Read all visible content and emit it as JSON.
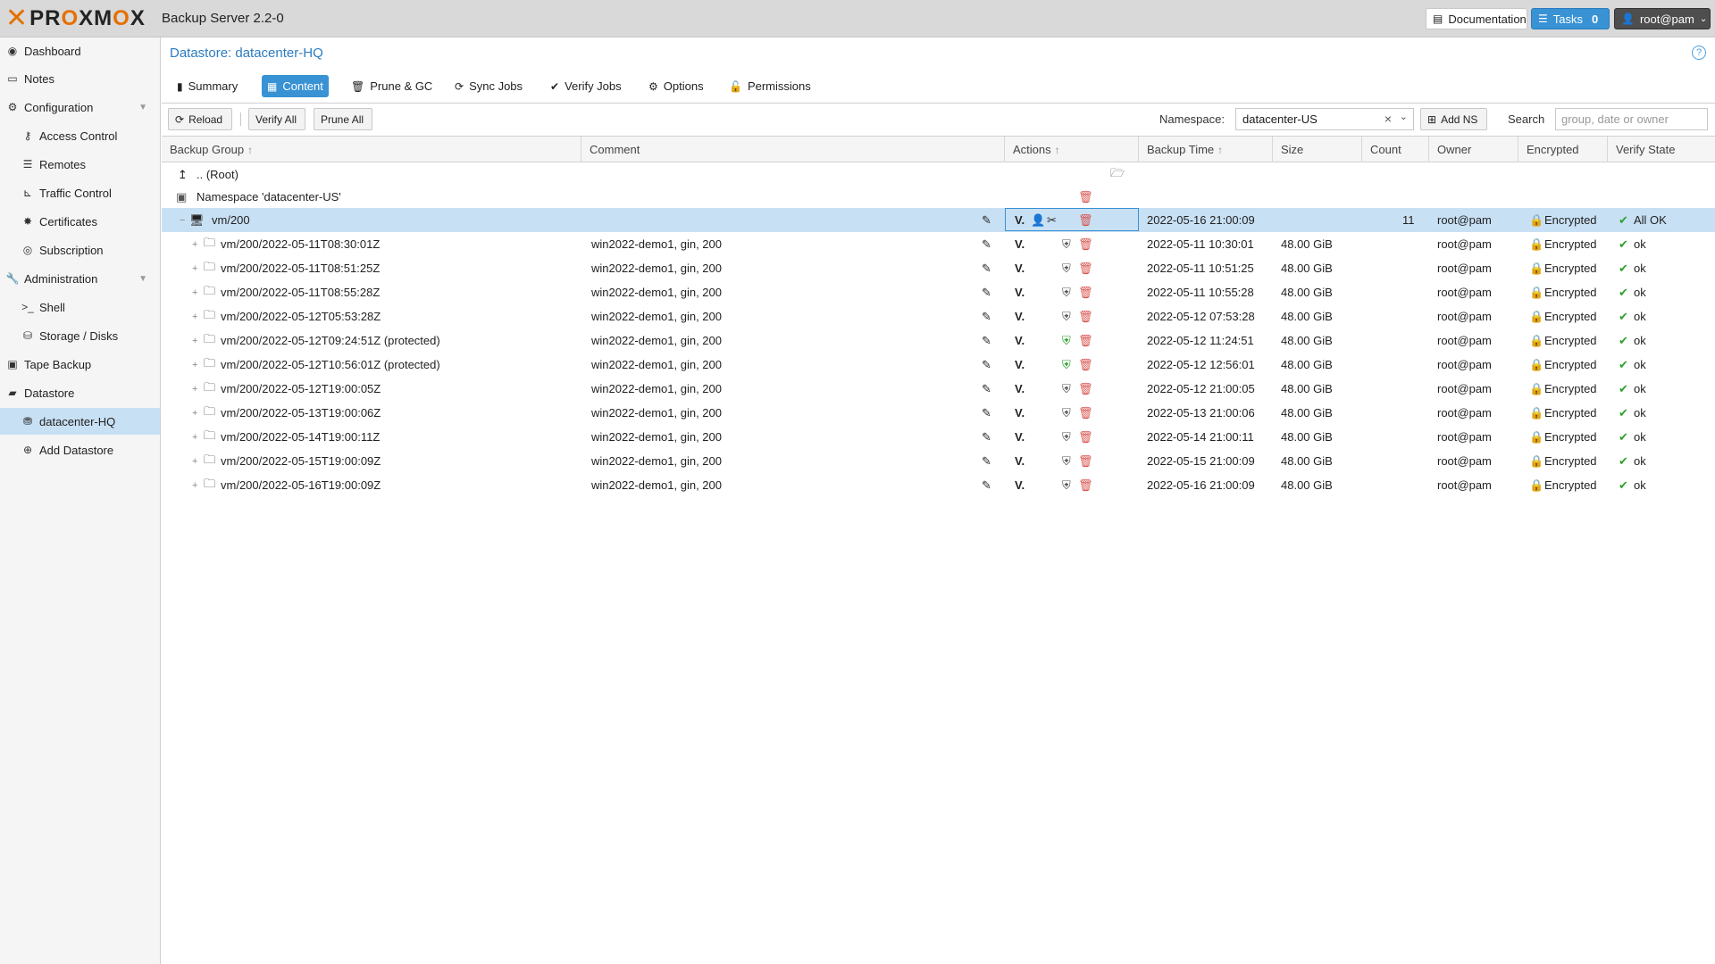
{
  "topbar": {
    "logo_text": "PROXMOX",
    "product": "Backup Server 2.2-0",
    "documentation": "Documentation",
    "tasks_label": "Tasks",
    "tasks_count": "0",
    "user": "root@pam"
  },
  "sidebar": {
    "items": [
      {
        "label": "Dashboard",
        "icon": "dashboard-icon"
      },
      {
        "label": "Notes",
        "icon": "notes-icon"
      },
      {
        "label": "Configuration",
        "icon": "gears-icon"
      },
      {
        "label": "Access Control",
        "icon": "key-icon"
      },
      {
        "label": "Remotes",
        "icon": "server-icon"
      },
      {
        "label": "Traffic Control",
        "icon": "chart-icon"
      },
      {
        "label": "Certificates",
        "icon": "certificate-icon"
      },
      {
        "label": "Subscription",
        "icon": "support-icon"
      },
      {
        "label": "Administration",
        "icon": "wrench-icon"
      },
      {
        "label": "Shell",
        "icon": "terminal-icon"
      },
      {
        "label": "Storage / Disks",
        "icon": "hdd-icon"
      },
      {
        "label": "Tape Backup",
        "icon": "tape-icon"
      },
      {
        "label": "Datastore",
        "icon": "archive-icon"
      },
      {
        "label": "datacenter-HQ",
        "icon": "database-icon"
      },
      {
        "label": "Add Datastore",
        "icon": "plus-circle-icon"
      }
    ]
  },
  "main": {
    "title": "Datastore: datacenter-HQ",
    "tabs": [
      "Summary",
      "Content",
      "Prune & GC",
      "Sync Jobs",
      "Verify Jobs",
      "Options",
      "Permissions"
    ],
    "active_tab": "Content"
  },
  "toolbar": {
    "reload": "Reload",
    "verify_all": "Verify All",
    "prune_all": "Prune All",
    "namespace_label": "Namespace:",
    "namespace_value": "datacenter-US",
    "add_ns": "Add NS",
    "search_label": "Search",
    "search_placeholder": "group, date or owner"
  },
  "grid": {
    "columns": [
      "Backup Group",
      "Comment",
      "Actions",
      "Backup Time",
      "Size",
      "Count",
      "Owner",
      "Encrypted",
      "Verify State"
    ],
    "root_label": ".. (Root)",
    "namespace_row": "Namespace 'datacenter-US'",
    "group": {
      "name": "vm/200",
      "backup_time": "2022-05-16 21:00:09",
      "count": "11",
      "owner": "root@pam",
      "encrypted": "Encrypted",
      "verify": "All OK"
    },
    "snapshots": [
      {
        "name": "vm/200/2022-05-11T08:30:01Z",
        "comment": "win2022-demo1, gin, 200",
        "time": "2022-05-11 10:30:01",
        "size": "48.00 GiB",
        "owner": "root@pam",
        "encrypted": "Encrypted",
        "verify": "ok",
        "protected": false
      },
      {
        "name": "vm/200/2022-05-11T08:51:25Z",
        "comment": "win2022-demo1, gin, 200",
        "time": "2022-05-11 10:51:25",
        "size": "48.00 GiB",
        "owner": "root@pam",
        "encrypted": "Encrypted",
        "verify": "ok",
        "protected": false
      },
      {
        "name": "vm/200/2022-05-11T08:55:28Z",
        "comment": "win2022-demo1, gin, 200",
        "time": "2022-05-11 10:55:28",
        "size": "48.00 GiB",
        "owner": "root@pam",
        "encrypted": "Encrypted",
        "verify": "ok",
        "protected": false
      },
      {
        "name": "vm/200/2022-05-12T05:53:28Z",
        "comment": "win2022-demo1, gin, 200",
        "time": "2022-05-12 07:53:28",
        "size": "48.00 GiB",
        "owner": "root@pam",
        "encrypted": "Encrypted",
        "verify": "ok",
        "protected": false
      },
      {
        "name": "vm/200/2022-05-12T09:24:51Z (protected)",
        "comment": "win2022-demo1, gin, 200",
        "time": "2022-05-12 11:24:51",
        "size": "48.00 GiB",
        "owner": "root@pam",
        "encrypted": "Encrypted",
        "verify": "ok",
        "protected": true
      },
      {
        "name": "vm/200/2022-05-12T10:56:01Z (protected)",
        "comment": "win2022-demo1, gin, 200",
        "time": "2022-05-12 12:56:01",
        "size": "48.00 GiB",
        "owner": "root@pam",
        "encrypted": "Encrypted",
        "verify": "ok",
        "protected": true
      },
      {
        "name": "vm/200/2022-05-12T19:00:05Z",
        "comment": "win2022-demo1, gin, 200",
        "time": "2022-05-12 21:00:05",
        "size": "48.00 GiB",
        "owner": "root@pam",
        "encrypted": "Encrypted",
        "verify": "ok",
        "protected": false
      },
      {
        "name": "vm/200/2022-05-13T19:00:06Z",
        "comment": "win2022-demo1, gin, 200",
        "time": "2022-05-13 21:00:06",
        "size": "48.00 GiB",
        "owner": "root@pam",
        "encrypted": "Encrypted",
        "verify": "ok",
        "protected": false
      },
      {
        "name": "vm/200/2022-05-14T19:00:11Z",
        "comment": "win2022-demo1, gin, 200",
        "time": "2022-05-14 21:00:11",
        "size": "48.00 GiB",
        "owner": "root@pam",
        "encrypted": "Encrypted",
        "verify": "ok",
        "protected": false
      },
      {
        "name": "vm/200/2022-05-15T19:00:09Z",
        "comment": "win2022-demo1, gin, 200",
        "time": "2022-05-15 21:00:09",
        "size": "48.00 GiB",
        "owner": "root@pam",
        "encrypted": "Encrypted",
        "verify": "ok",
        "protected": false
      },
      {
        "name": "vm/200/2022-05-16T19:00:09Z",
        "comment": "win2022-demo1, gin, 200",
        "time": "2022-05-16 21:00:09",
        "size": "48.00 GiB",
        "owner": "root@pam",
        "encrypted": "Encrypted",
        "verify": "ok",
        "protected": false
      }
    ]
  },
  "colors": {
    "accent": "#3892d4",
    "brand_orange": "#e57000",
    "selection": "#c8e0f4",
    "ok_green": "#2ca02c",
    "delete_red": "#d9534f"
  }
}
